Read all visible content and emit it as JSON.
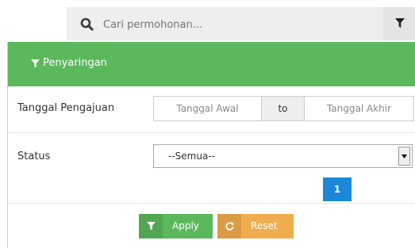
{
  "search": {
    "placeholder": "Cari permohonan..."
  },
  "filter_panel": {
    "title": "Penyaringan",
    "date_row": {
      "label": "Tanggal Pengajuan",
      "start_placeholder": "Tanggal Awal",
      "to_label": "to",
      "end_placeholder": "Tanggal Akhir"
    },
    "status_row": {
      "label": "Status",
      "selected": "--Semua--"
    },
    "pagination_badge": "1",
    "apply_label": "Apply",
    "reset_label": "Reset"
  },
  "colors": {
    "panel_header": "#5cb85c",
    "apply": "#5cb85c",
    "reset": "#f0ad4e",
    "badge": "#1b87d6"
  },
  "icons": [
    "search-icon",
    "filter-icon",
    "reset-icon",
    "dropdown-arrow-icon"
  ]
}
